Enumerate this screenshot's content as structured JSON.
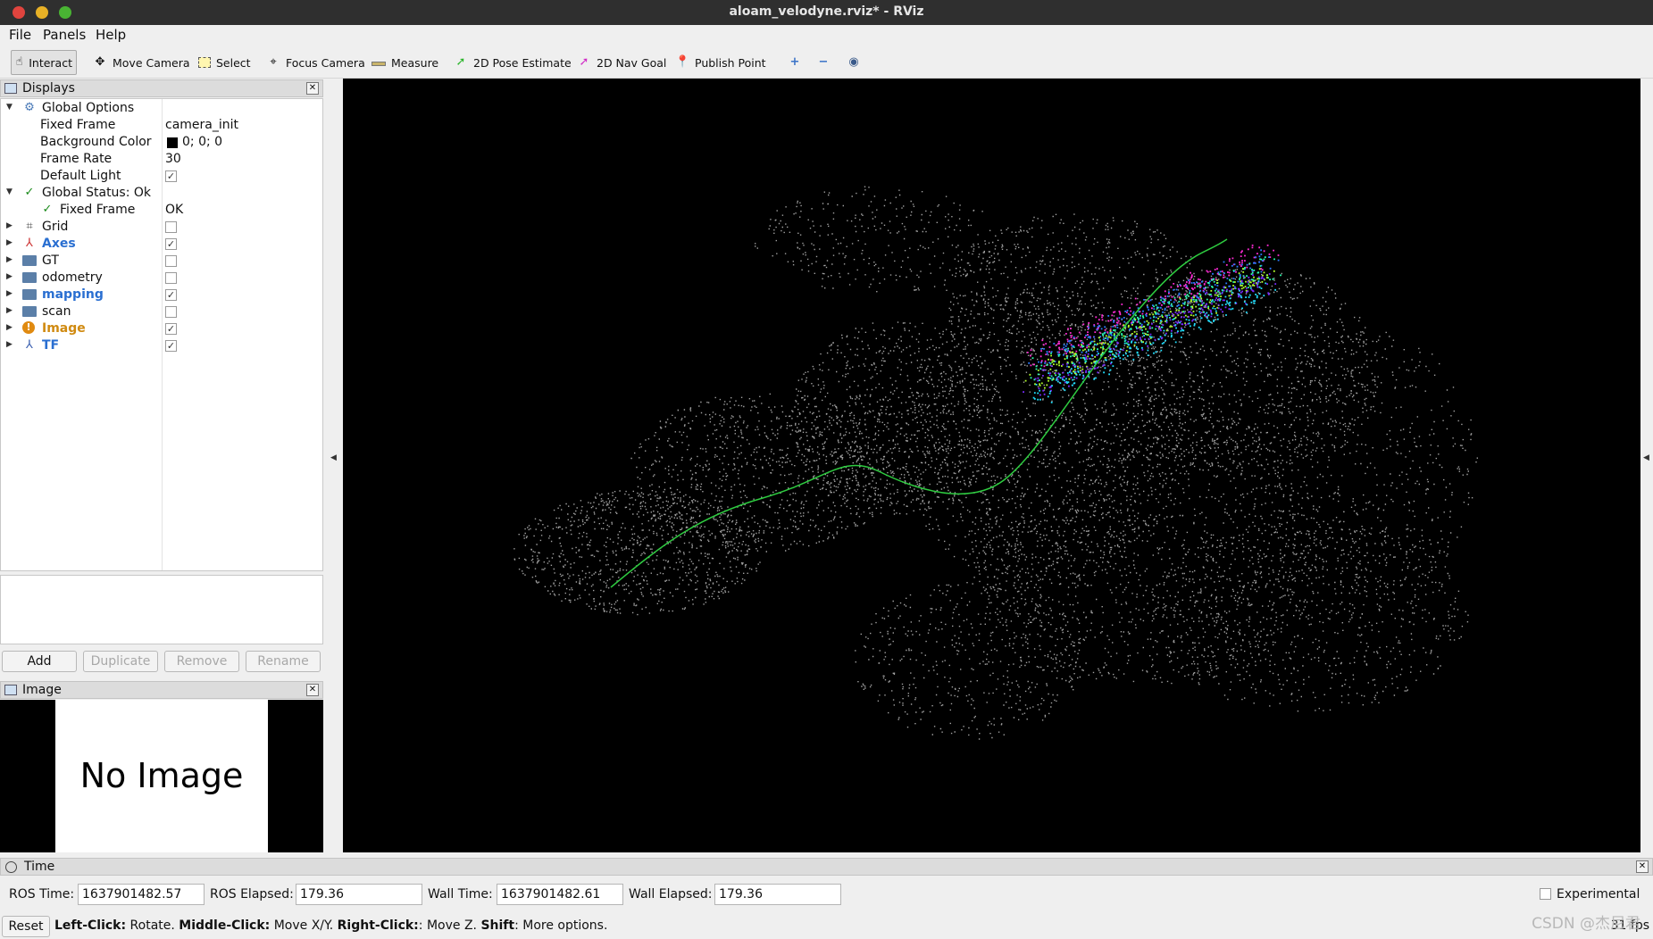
{
  "window": {
    "title": "aloam_velodyne.rviz* - RViz"
  },
  "menu": [
    {
      "label": "File"
    },
    {
      "label": "Panels"
    },
    {
      "label": "Help"
    }
  ],
  "toolbar": {
    "tools": [
      {
        "label": "Interact",
        "icon": "hand-icon",
        "active": true
      },
      {
        "label": "Move Camera",
        "icon": "move-camera-icon"
      },
      {
        "label": "Select",
        "icon": "select-icon"
      },
      {
        "label": "Focus Camera",
        "icon": "focus-camera-icon"
      },
      {
        "label": "Measure",
        "icon": "ruler-icon"
      },
      {
        "label": "2D Pose Estimate",
        "icon": "green-arrow-icon"
      },
      {
        "label": "2D Nav Goal",
        "icon": "magenta-arrow-icon"
      },
      {
        "label": "Publish Point",
        "icon": "map-pin-icon"
      }
    ]
  },
  "displays": {
    "title": "Displays",
    "rows": [
      {
        "label": "Global Options",
        "value": ""
      },
      {
        "label": "Fixed Frame",
        "value": "camera_init"
      },
      {
        "label": "Background Color",
        "value": "0; 0; 0"
      },
      {
        "label": "Frame Rate",
        "value": "30"
      },
      {
        "label": "Default Light",
        "value": ""
      },
      {
        "label": "Global Status: Ok",
        "value": ""
      },
      {
        "label": "Fixed Frame",
        "value": "OK"
      },
      {
        "label": "Grid",
        "value": ""
      },
      {
        "label": "Axes",
        "value": ""
      },
      {
        "label": "GT",
        "value": ""
      },
      {
        "label": "odometry",
        "value": ""
      },
      {
        "label": "mapping",
        "value": ""
      },
      {
        "label": "scan",
        "value": ""
      },
      {
        "label": "Image",
        "value": ""
      },
      {
        "label": "TF",
        "value": ""
      }
    ],
    "checks": {
      "default_light": true,
      "grid": false,
      "axes": true,
      "gt": false,
      "odometry": false,
      "mapping": true,
      "scan": false,
      "image": true,
      "tf": true
    },
    "buttons": {
      "add": "Add",
      "duplicate": "Duplicate",
      "remove": "Remove",
      "rename": "Rename"
    }
  },
  "image_panel": {
    "title": "Image",
    "placeholder": "No Image"
  },
  "time_panel": {
    "title": "Time",
    "ros_time_label": "ROS Time:",
    "ros_time": "1637901482.57",
    "ros_elapsed_label": "ROS Elapsed:",
    "ros_elapsed": "179.36",
    "wall_time_label": "Wall Time:",
    "wall_time": "1637901482.61",
    "wall_elapsed_label": "Wall Elapsed:",
    "wall_elapsed": "179.36",
    "experimental_label": "Experimental"
  },
  "status": {
    "reset": "Reset",
    "k1": "Left-Click:",
    "t1": " Rotate. ",
    "k2": "Middle-Click:",
    "t2": " Move X/Y. ",
    "k3": "Right-Click:",
    "t3": ": Move Z. ",
    "k4": "Shift",
    "t4": ": More options.",
    "fps": "31 fps",
    "watermark": "CSDN @杰尼君"
  },
  "colors": {
    "link_blue": "#2a6fd1",
    "warn_orange": "#d08a10",
    "ok_green": "#1a8a1a",
    "trajectory": "#2ecc40"
  }
}
